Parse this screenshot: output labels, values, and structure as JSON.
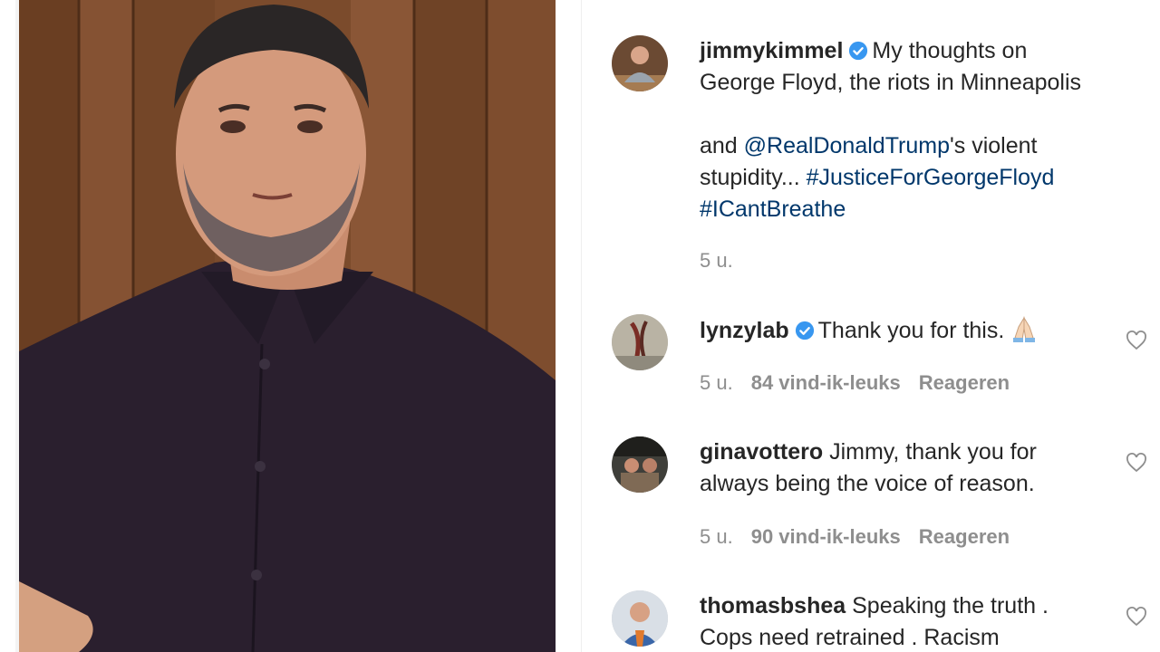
{
  "post": {
    "username": "jimmykimmel",
    "caption_line1": "My thoughts on",
    "caption_line2": "George Floyd, the riots in Minneapolis",
    "caption_and": "and",
    "mention": "@RealDonaldTrump",
    "caption_suffix": "'s violent",
    "caption_stupidity": "stupidity...",
    "hashtag1": "#JusticeForGeorgeFloyd",
    "hashtag2": "#ICantBreathe",
    "time": "5 u."
  },
  "comments": [
    {
      "username": "lynzylab",
      "verified": true,
      "text": "Thank you for this.",
      "emoji": "folded-hands",
      "time": "5 u.",
      "likes": "84 vind-ik-leuks",
      "reply": "Reageren"
    },
    {
      "username": "ginavottero",
      "verified": false,
      "text_line1": "Jimmy, thank you for",
      "text_line2": "always being the voice of reason.",
      "time": "5 u.",
      "likes": "90 vind-ik-leuks",
      "reply": "Reageren"
    },
    {
      "username": "thomasbshea",
      "verified": false,
      "text_line1": "Speaking the truth .",
      "text_line2": "Cops need retrained . Racism"
    }
  ],
  "icons": {
    "verified": "verified-badge-icon",
    "like": "heart-icon"
  },
  "colors": {
    "link": "#00376b",
    "verified": "#3897f0",
    "meta": "#8e8e8e",
    "text": "#262626"
  }
}
